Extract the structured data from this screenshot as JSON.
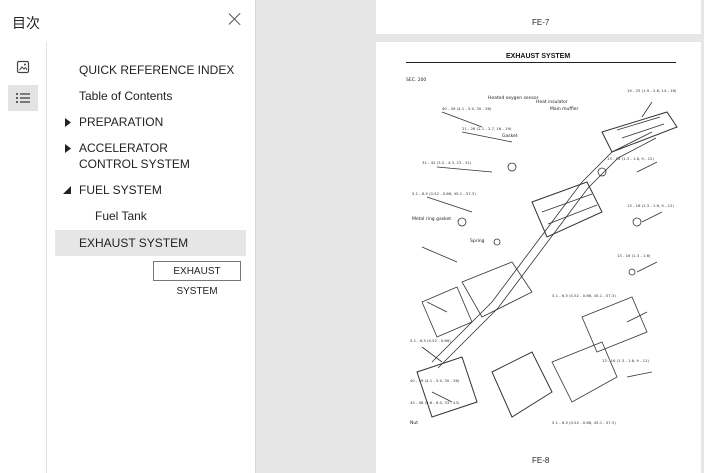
{
  "sidebar": {
    "title": "目次",
    "toc": [
      {
        "label": "QUICK REFERENCE INDEX"
      },
      {
        "label": "Table of Contents"
      },
      {
        "label": "PREPARATION"
      },
      {
        "label": "ACCELERATOR CONTROL SYSTEM"
      },
      {
        "label": "FUEL SYSTEM"
      },
      {
        "label": "Fuel Tank"
      },
      {
        "label": "EXHAUST SYSTEM"
      }
    ],
    "tooltip": "EXHAUST SYSTEM"
  },
  "pages": {
    "page_top_number": "FE-7",
    "page_title": "EXHAUST SYSTEM",
    "page_bottom_number": "FE-8",
    "diagram_labels": {
      "engine": "SEC. 200",
      "sensor": "Heated oxygen sensor",
      "bracket": "Heat insulator",
      "mainmuffler": "Main muffler",
      "gasket": "Gasket",
      "metalring": "Metal ring gasket",
      "spring": "Spring",
      "nut": "Nut"
    }
  }
}
